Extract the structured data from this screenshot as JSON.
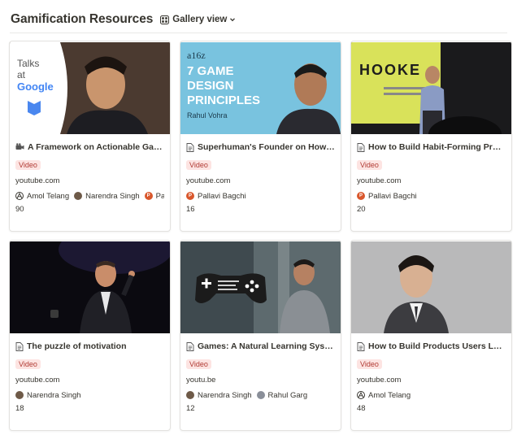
{
  "page": {
    "title": "Gamification Resources"
  },
  "view": {
    "label": "Gallery view"
  },
  "cards": [
    {
      "title": "A Framework on Actionable Gamifi...",
      "title_icon": "video-camera-icon",
      "tag": "Video",
      "domain": "youtube.com",
      "people": [
        {
          "name": "Amol Telang",
          "avatar": "outline"
        },
        {
          "name": "Narendra Singh",
          "avatar": "photo"
        },
        {
          "name": "Pallavi B",
          "avatar": "orange",
          "initial": "P"
        }
      ],
      "count": "90",
      "thumb": {
        "line1": "Talks",
        "line2": "at",
        "brand": "Google"
      }
    },
    {
      "title": "Superhuman's Founder on How to...",
      "title_icon": "page-icon",
      "tag": "Video",
      "domain": "youtube.com",
      "people": [
        {
          "name": "Pallavi Bagchi",
          "avatar": "orange",
          "initial": "P"
        }
      ],
      "count": "16",
      "thumb": {
        "brand": "a16z",
        "line1": "7 GAME",
        "line2": "DESIGN",
        "line3": "PRINCIPLES",
        "sub": "Rahul Vohra"
      }
    },
    {
      "title": "How to Build Habit-Forming Produ...",
      "title_icon": "page-icon",
      "tag": "Video",
      "domain": "youtube.com",
      "people": [
        {
          "name": "Pallavi Bagchi",
          "avatar": "orange",
          "initial": "P"
        }
      ],
      "count": "20",
      "thumb": {
        "book": "HOOKE"
      }
    },
    {
      "title": "The puzzle of motivation",
      "title_icon": "page-icon",
      "tag": "Video",
      "domain": "youtube.com",
      "people": [
        {
          "name": "Narendra Singh",
          "avatar": "photo"
        }
      ],
      "count": "18",
      "thumb": {}
    },
    {
      "title": "Games: A Natural Learning Syste...",
      "title_icon": "page-icon",
      "tag": "Video",
      "domain": "youtu.be",
      "people": [
        {
          "name": "Narendra Singh",
          "avatar": "photo"
        },
        {
          "name": "Rahul Garg",
          "avatar": "photo2"
        }
      ],
      "count": "12",
      "thumb": {}
    },
    {
      "title": "How to Build Products Users Love ...",
      "title_icon": "page-icon",
      "tag": "Video",
      "domain": "youtube.com",
      "people": [
        {
          "name": "Amol Telang",
          "avatar": "outline"
        }
      ],
      "count": "48",
      "thumb": {}
    }
  ],
  "colors": {
    "tag_bg": "#fde4e2",
    "tag_text": "#b13b34",
    "google_blue": "#4285f4",
    "a16z_bg": "#79c3df",
    "book_yellow": "#d9e25a"
  }
}
